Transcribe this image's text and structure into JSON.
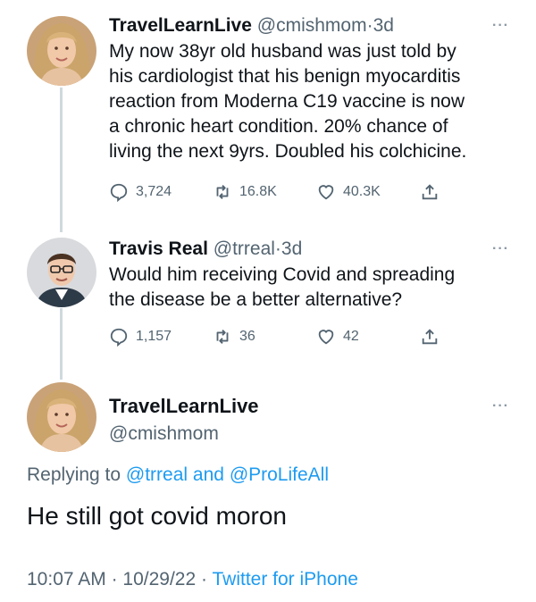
{
  "colors": {
    "text": "#0f1419",
    "secondary": "#536471",
    "link": "#1d9bf0",
    "thread_line": "#cfd9de"
  },
  "tweet1": {
    "name": "TravelLearnLive",
    "handle": "@cmishmom",
    "separator": "·",
    "time": "3d",
    "more": "···",
    "lines": [
      "My now 38yr old husband was just told by",
      "his cardiologist that his benign myocarditis",
      "reaction from Moderna C19 vaccine is now",
      "a chronic heart condition. 20% chance of",
      "living the next 9yrs. Doubled his colchicine."
    ],
    "replies": "3,724",
    "retweets": "16.8K",
    "likes": "40.3K",
    "icons": [
      "reply-icon",
      "retweet-icon",
      "like-icon",
      "share-icon"
    ]
  },
  "tweet2": {
    "name": "Travis Real",
    "handle": "@trreal",
    "separator": "·",
    "time": "3d",
    "more": "···",
    "lines": [
      "Would him receiving Covid and spreading",
      "the disease be a better alternative?"
    ],
    "replies": "1,157",
    "retweets": "36",
    "likes": "42"
  },
  "main": {
    "name": "TravelLearnLive",
    "handle": "@cmishmom",
    "more": "···",
    "replying_prefix": "Replying to",
    "replying_user1": "@trreal",
    "replying_and": "and",
    "replying_user2": "@ProLifeAll",
    "text": "He still got covid moron",
    "time": "10:07 AM",
    "separator": "·",
    "date": "10/29/22",
    "separator2": "·",
    "source": "Twitter for iPhone"
  }
}
